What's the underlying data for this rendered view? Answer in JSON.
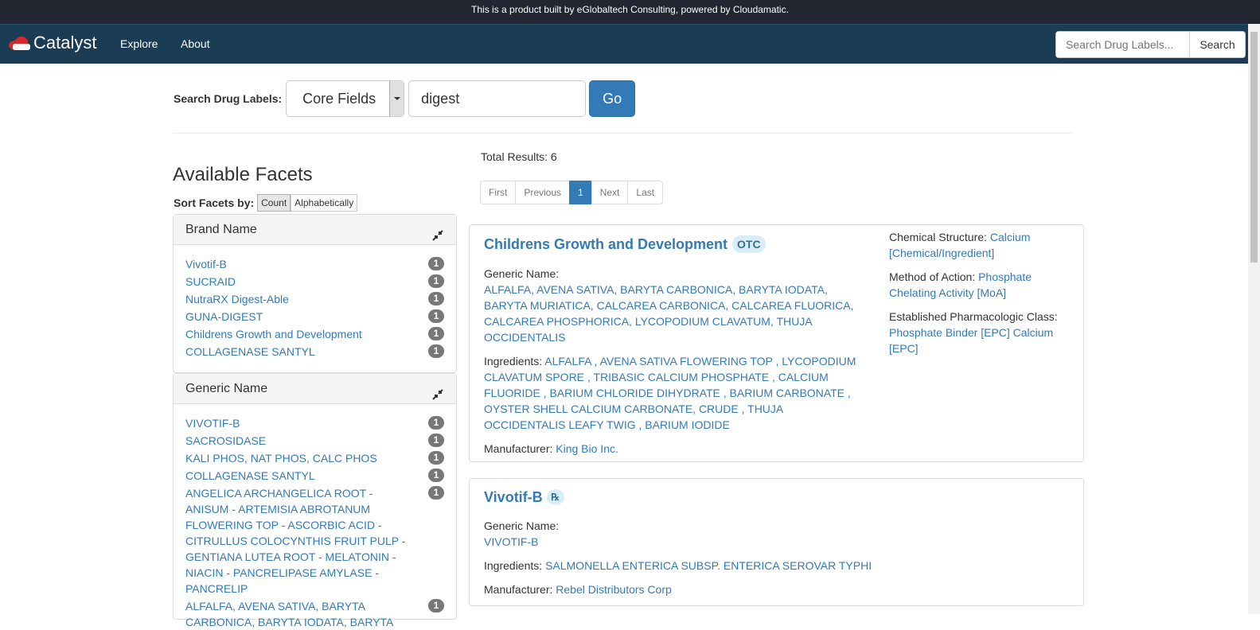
{
  "topbar": {
    "text": "This is a product built by eGlobaltech Consulting, powered by Cloudamatic."
  },
  "navbar": {
    "brand": "Catalyst",
    "links": [
      "Explore",
      "About"
    ],
    "search_placeholder": "Search Drug Labels...",
    "search_button": "Search"
  },
  "search": {
    "label": "Search Drug Labels:",
    "field_select": "Core Fields",
    "query": "digest",
    "go": "Go"
  },
  "facets": {
    "title": "Available Facets",
    "sort_label": "Sort Facets by:",
    "sort_options": [
      "Count",
      "Alphabetically"
    ],
    "brand": {
      "heading": "Brand Name",
      "items": [
        {
          "label": "Vivotif-B",
          "count": "1"
        },
        {
          "label": "SUCRAID",
          "count": "1"
        },
        {
          "label": "NutraRX Digest-Able",
          "count": "1"
        },
        {
          "label": "GUNA-DIGEST",
          "count": "1"
        },
        {
          "label": "Childrens Growth and Development",
          "count": "1"
        },
        {
          "label": "COLLAGENASE SANTYL",
          "count": "1"
        }
      ]
    },
    "generic": {
      "heading": "Generic Name",
      "items": [
        {
          "label": "VIVOTIF-B",
          "count": "1"
        },
        {
          "label": "SACROSIDASE",
          "count": "1"
        },
        {
          "label": "KALI PHOS, NAT PHOS, CALC PHOS",
          "count": "1"
        },
        {
          "label": "COLLAGENASE SANTYL",
          "count": "1"
        },
        {
          "label": "ANGELICA ARCHANGELICA ROOT - ANISUM - ARTEMISIA ABROTANUM FLOWERING TOP - ASCORBIC ACID - CITRULLUS COLOCYNTHIS FRUIT PULP - GENTIANA LUTEA ROOT - MELATONIN - NIACIN - PANCRELIPASE AMYLASE - PANCRELIP",
          "count": "1"
        },
        {
          "label": "ALFALFA, AVENA SATIVA, BARYTA CARBONICA, BARYTA IODATA, BARYTA",
          "count": "1"
        }
      ]
    }
  },
  "results": {
    "total": "Total Results: 6",
    "pager": [
      "First",
      "Previous",
      "1",
      "Next",
      "Last"
    ],
    "items": [
      {
        "title": "Childrens Growth and Development",
        "badge": "OTC",
        "generic_label": "Generic Name:",
        "generic": "ALFALFA, AVENA SATIVA, BARYTA CARBONICA, BARYTA IODATA, BARYTA MURIATICA, CALCAREA CARBONICA, CALCAREA FLUORICA, CALCAREA PHOSPHORICA, LYCOPODIUM CLAVATUM, THUJA OCCIDENTALIS",
        "ingredients_label": "Ingredients:",
        "ingredients": "ALFALFA , AVENA SATIVA FLOWERING TOP , LYCOPODIUM CLAVATUM SPORE , TRIBASIC CALCIUM PHOSPHATE , CALCIUM FLUORIDE , BARIUM CHLORIDE DIHYDRATE , BARIUM CARBONATE , OYSTER SHELL CALCIUM CARBONATE, CRUDE , THUJA OCCIDENTALIS LEAFY TWIG , BARIUM IODIDE",
        "manufacturer_label": "Manufacturer:",
        "manufacturer": "King Bio Inc.",
        "chem_label": "Chemical Structure:",
        "chem": "Calcium [Chemical/Ingredient]",
        "moa_label": "Method of Action:",
        "moa": "Phosphate Chelating Activity [MoA]",
        "epc_label": "Established Pharmacologic Class:",
        "epc": "Phosphate Binder [EPC] Calcium [EPC]"
      },
      {
        "title": "Vivotif-B",
        "badge": "℞",
        "generic_label": "Generic Name:",
        "generic": "VIVOTIF-B",
        "ingredients_label": "Ingredients:",
        "ingredients": "SALMONELLA ENTERICA SUBSP. ENTERICA SEROVAR TYPHI",
        "manufacturer_label": "Manufacturer:",
        "manufacturer": "Rebel Distributors Corp"
      }
    ]
  }
}
